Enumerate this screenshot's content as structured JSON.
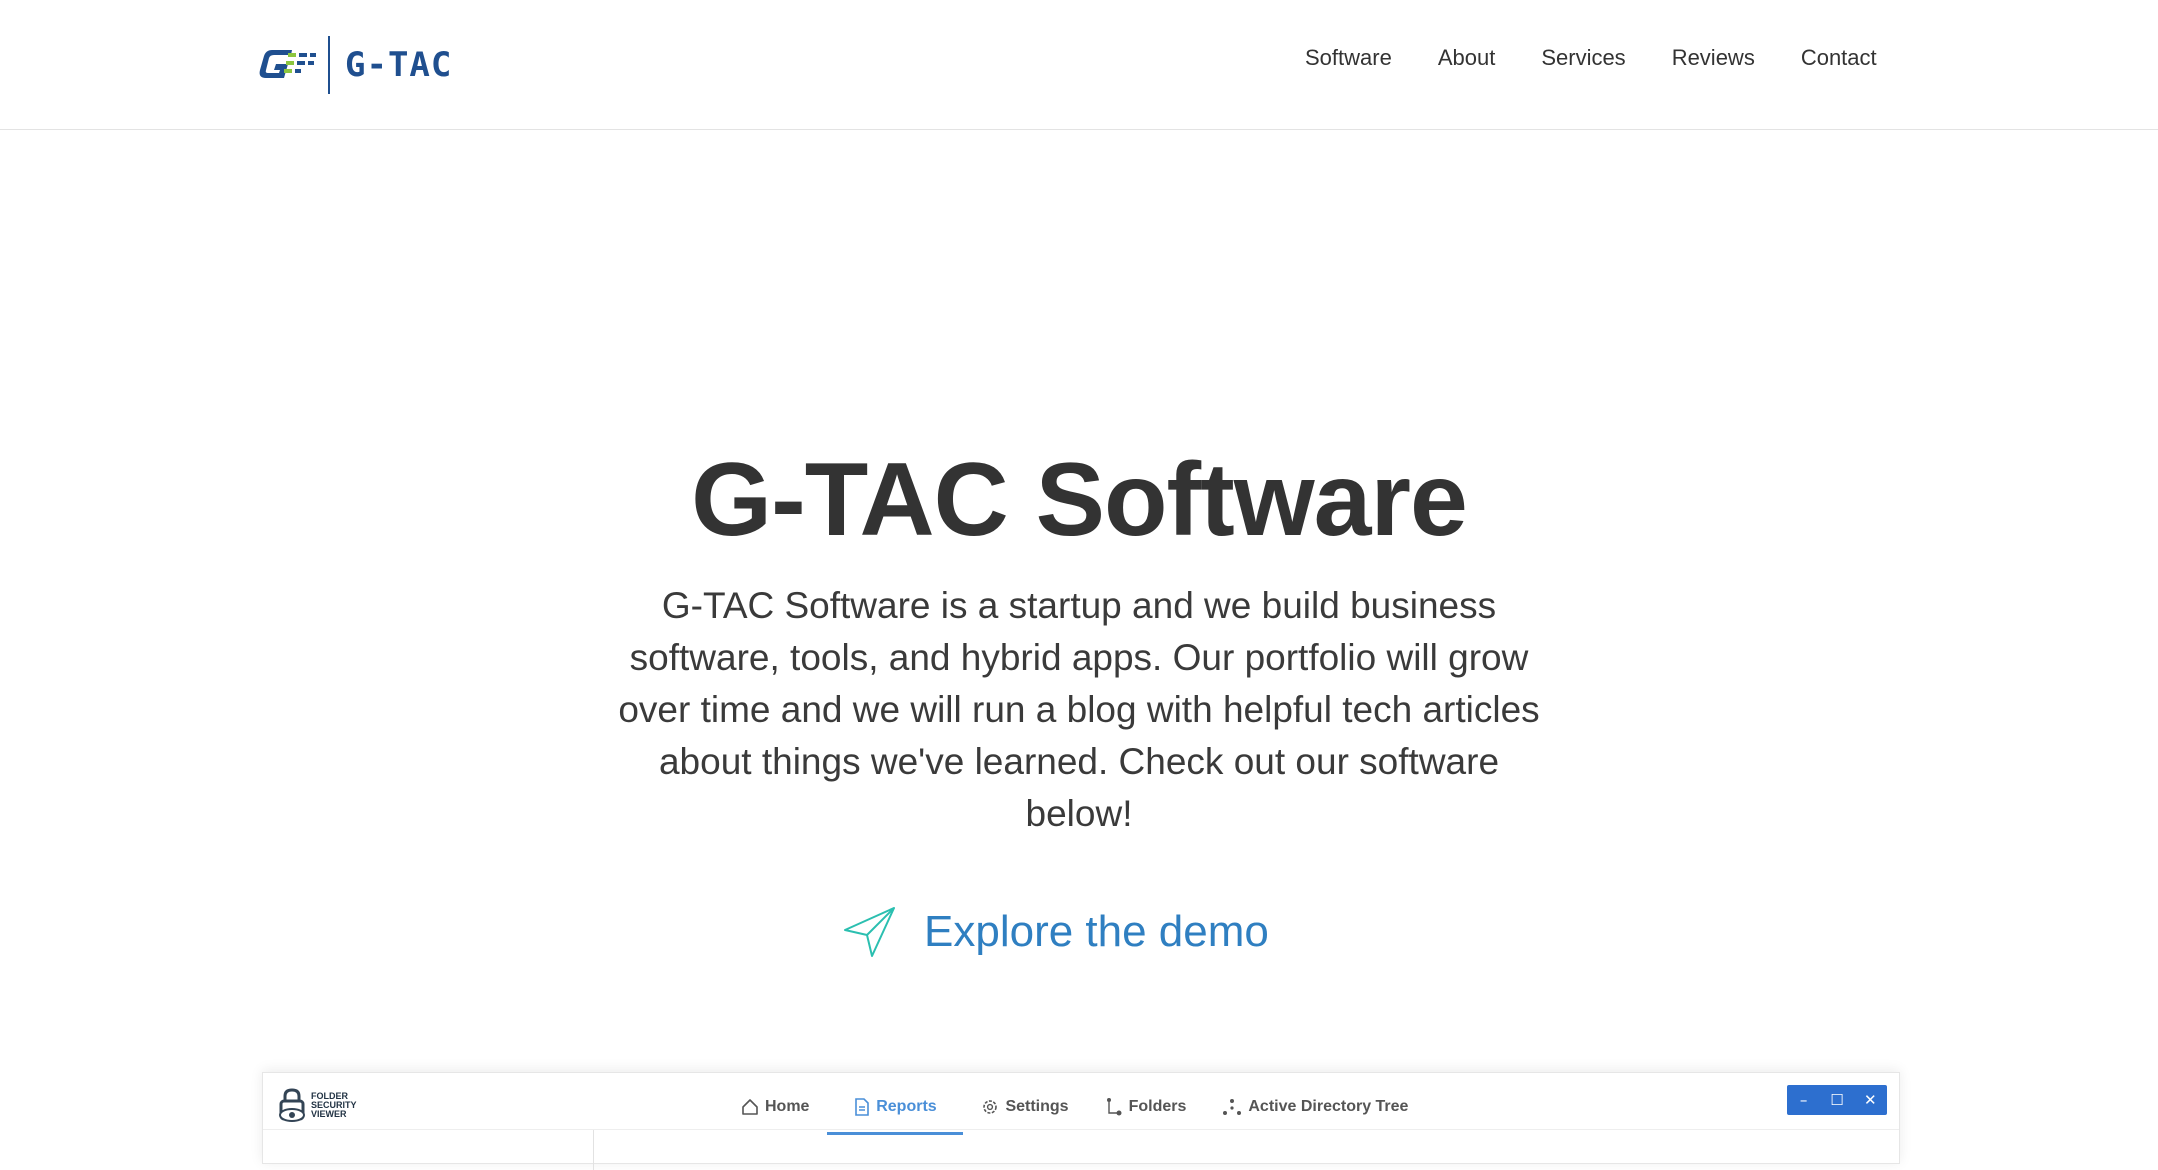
{
  "brand": {
    "name": "G-TAC",
    "colors": {
      "blue": "#1f4f8f",
      "green": "#8cc63f",
      "accent": "#2f7fc1",
      "icon": "#2bbfb0"
    }
  },
  "nav": {
    "items": [
      "Software",
      "About",
      "Services",
      "Reviews",
      "Contact"
    ]
  },
  "hero": {
    "title": "G-TAC Software",
    "description": "G-TAC Software is a startup and we build business software, tools, and hybrid apps. Our portfolio will grow over time and we will run a blog with helpful tech articles about things we've learned. Check out our software below!",
    "cta_label": "Explore the demo",
    "cta_icon": "paper-plane-icon"
  },
  "preview": {
    "app_name": "FOLDER SECURITY VIEWER",
    "tabs": [
      {
        "label": "Home",
        "icon": "home-icon"
      },
      {
        "label": "Reports",
        "icon": "document-icon",
        "active": true
      },
      {
        "label": "Settings",
        "icon": "gear-icon"
      },
      {
        "label": "Folders",
        "icon": "folder-tree-icon"
      },
      {
        "label": "Active Directory Tree",
        "icon": "network-icon"
      }
    ],
    "window_controls": {
      "minimize": "–",
      "maximize": "☐",
      "close": "✕"
    },
    "accent_color": "#4a8fd8",
    "titlebar_color": "#2d6fcf"
  }
}
